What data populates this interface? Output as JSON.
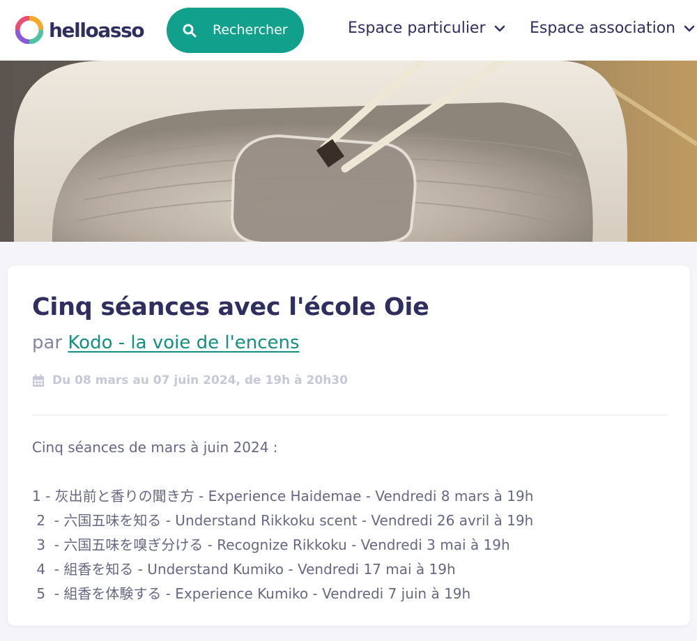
{
  "header": {
    "logo_text": "helloasso",
    "search_label": "Rechercher",
    "nav": [
      {
        "label": "Espace particulier"
      },
      {
        "label": "Espace association"
      }
    ]
  },
  "colors": {
    "brand_green": "#11a08b",
    "primary_text": "#2e2f5e",
    "muted_text": "#84859e"
  },
  "event": {
    "title": "Cinq séances avec l'école Oie",
    "by_prefix": "par",
    "organizer": "Kodo - la voie de l'encens",
    "date": "Du 08 mars au 07 juin 2024, de 19h à 20h30",
    "description_intro": "Cinq séances de mars à juin 2024 :",
    "sessions": [
      "1 - 灰出前と香りの聞き方 - Experience Haidemae - Vendredi 8 mars à 19h",
      " 2  - 六国五味を知る - Understand Rikkoku scent - Vendredi 26 avril à 19h",
      " 3  - 六国五味を嗅ぎ分ける - Recognize Rikkoku - Vendredi 3 mai à 19h",
      " 4  - 組香を知る - Understand Kumiko - Vendredi 17 mai à 19h",
      " 5  - 組香を体験する - Experience Kumiko - Vendredi 7 juin à 19h"
    ]
  }
}
